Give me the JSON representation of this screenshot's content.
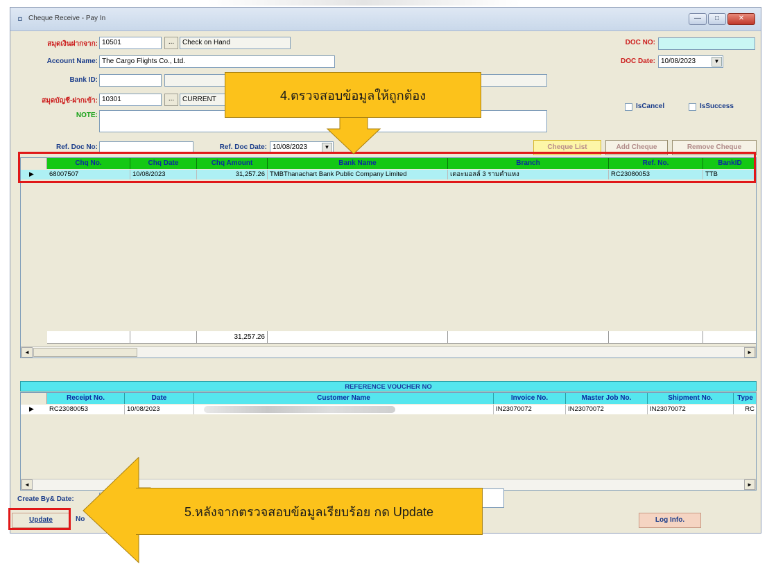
{
  "window": {
    "title": "Cheque Receive - Pay In",
    "controls": [
      "—",
      "□",
      "✕"
    ]
  },
  "form": {
    "ledger_label": "สมุดเงินฝากจาก:",
    "ledger_code": "10501",
    "ledger_name": "Check on Hand",
    "account_name_label": "Account Name:",
    "account_name": "The Cargo Flights Co., Ltd.",
    "bank_id_label": "Bank ID:",
    "bank_id": "",
    "deposit_label": "สมุดบัญชี-ฝากเข้า:",
    "deposit_code": "10301",
    "deposit_name": "CURRENT",
    "note_label": "NOTE:",
    "ref_doc_no_label": "Ref. Doc No:",
    "ref_doc_no": "",
    "ref_doc_date_label": "Ref. Doc Date:",
    "ref_doc_date": "10/08/2023",
    "doc_no_label": "DOC NO:",
    "doc_no": "",
    "doc_date_label": "DOC Date:",
    "doc_date": "10/08/2023",
    "is_cancel_label": "IsCancel",
    "is_success_label": "IsSuccess",
    "ellipsis": "...",
    "dropdown_arrow": "▼"
  },
  "buttons": {
    "cheque_list": "Cheque List",
    "add_cheque": "Add Cheque",
    "remove_cheque": "Remove Cheque",
    "update": "Update",
    "next_partial": "No",
    "log_info": "Log Info."
  },
  "cheque_grid": {
    "columns": [
      "Chq No.",
      "Chq Date",
      "Chq Amount",
      "Bank Name",
      "Branch",
      "Ref. No.",
      "BankID"
    ],
    "rows": [
      [
        "68007507",
        "10/08/2023",
        "31,257.26",
        "TMBThanachart Bank Public Company Limited",
        "เดอะมอลล์ 3 รามคำแหง",
        "RC23080053",
        "TTB"
      ]
    ],
    "total": "31,257.26"
  },
  "voucher": {
    "title": "REFERENCE VOUCHER NO",
    "columns": [
      "Receipt No.",
      "Date",
      "Customer Name",
      "Invoice No.",
      "Master Job No.",
      "Shipment No.",
      "Type"
    ],
    "rows": [
      [
        "RC23080053",
        "10/08/2023",
        "",
        "IN23070072",
        "IN23070072",
        "IN23070072",
        "RC"
      ]
    ]
  },
  "footer": {
    "create_by_label": "Create By& Date:"
  },
  "scroll": {
    "left": "◄",
    "right": "►"
  },
  "row_indicator": "▶",
  "annotations": {
    "step4": "4.ตรวจสอบข้อมูลให้ถูกต้อง",
    "step5": "5.หลังจากตรวจสอบข้อมูลเรียบร้อย กด Update"
  }
}
